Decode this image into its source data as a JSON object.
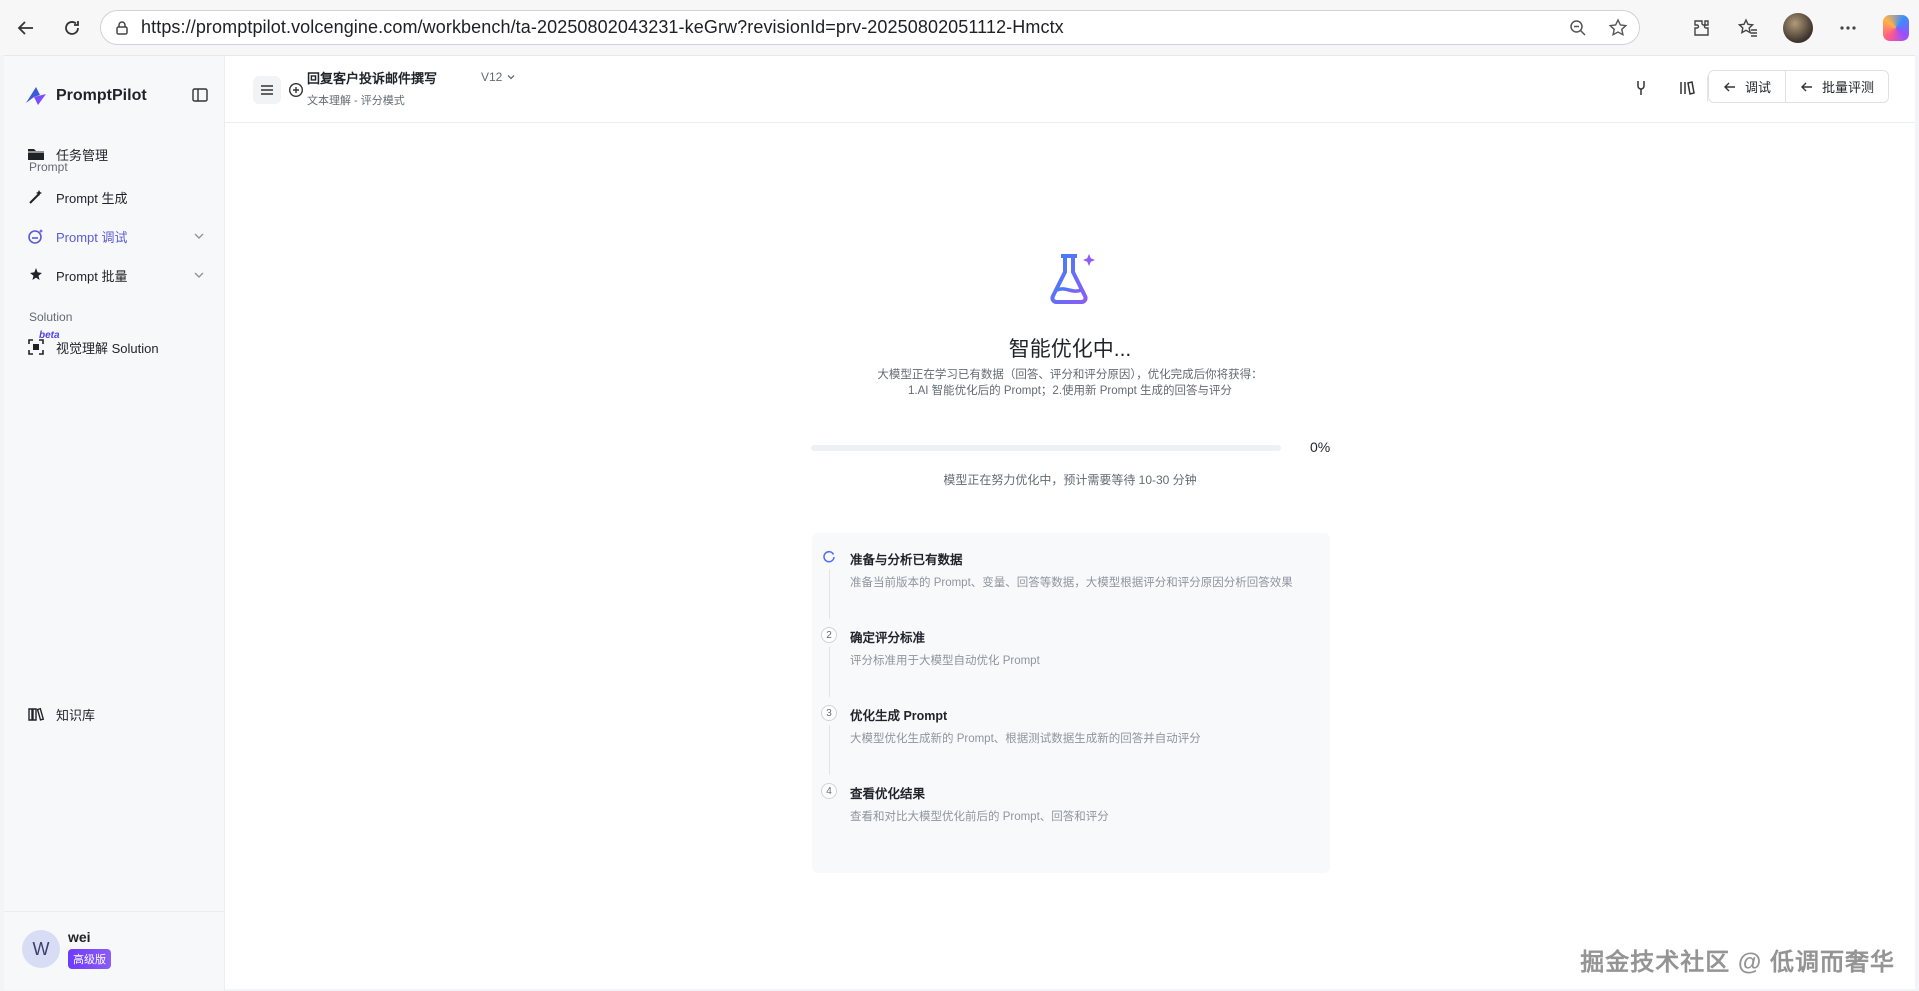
{
  "browser": {
    "url": "https://promptpilot.volcengine.com/workbench/ta-20250802043231-keGrw?revisionId=prv-20250802051112-Hmctx"
  },
  "sidebar": {
    "logo": "PromptPilot",
    "items": [
      {
        "label": "任务管理",
        "icon": "folder-icon"
      },
      {
        "label": "Prompt 生成",
        "icon": "magic-wand-icon"
      },
      {
        "label": "Prompt 调试",
        "icon": "debug-icon",
        "active": true
      },
      {
        "label": "Prompt 批量",
        "icon": "batch-icon"
      },
      {
        "label": "视觉理解 Solution",
        "icon": "vision-icon"
      },
      {
        "label": "知识库",
        "icon": "books-icon"
      }
    ],
    "sections": {
      "prompt": "Prompt",
      "solution": "Solution"
    },
    "beta": "beta",
    "user": {
      "initial": "W",
      "name": "wei",
      "badge": "高级版"
    },
    "accent": "#5b5bd6"
  },
  "header": {
    "title": "回复客户投诉邮件撰写",
    "version": "V12",
    "subtitle": "文本理解 - 评分模式",
    "actions": [
      "调试",
      "批量评测"
    ]
  },
  "main": {
    "title": "智能优化中...",
    "desc_line1": "大模型正在学习已有数据（回答、评分和评分原因），优化完成后你将获得：",
    "desc_line2": "1.AI 智能优化后的 Prompt；2.使用新 Prompt 生成的回答与评分",
    "progress_value": 0,
    "progress_text": "0%",
    "progress_hint": "模型正在努力优化中，预计需要等待 10-30 分钟",
    "steps": [
      {
        "num": "",
        "title": "准备与分析已有数据",
        "desc": "准备当前版本的 Prompt、变量、回答等数据，大模型根据评分和评分原因分析回答效果"
      },
      {
        "num": "2",
        "title": "确定评分标准",
        "desc": "评分标准用于大模型自动优化 Prompt"
      },
      {
        "num": "3",
        "title": "优化生成 Prompt",
        "desc": "大模型优化生成新的 Prompt、根据测试数据生成新的回答并自动评分"
      },
      {
        "num": "4",
        "title": "查看优化结果",
        "desc": "查看和对比大模型优化前后的 Prompt、回答和评分"
      }
    ]
  },
  "watermark": "掘金技术社区 @ 低调而奢华"
}
